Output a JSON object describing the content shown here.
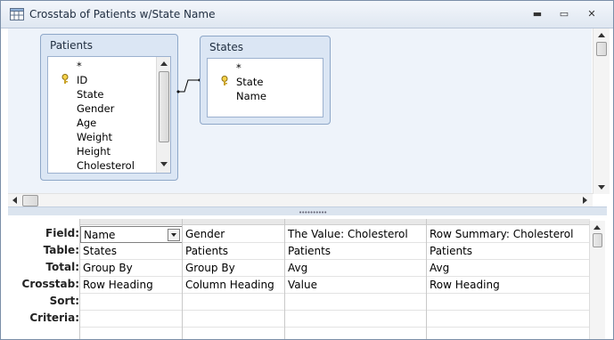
{
  "window": {
    "title": "Crosstab of Patients w/State Name",
    "minimize_glyph": "▬",
    "restore_glyph": "▭",
    "close_glyph": "✕"
  },
  "tables": {
    "patients": {
      "title": "Patients",
      "fields": [
        "*",
        "ID",
        "State",
        "Gender",
        "Age",
        "Weight",
        "Height",
        "Cholesterol"
      ],
      "key_field_index": 1
    },
    "states": {
      "title": "States",
      "fields": [
        "*",
        "State",
        "Name"
      ],
      "key_field_index": 1
    }
  },
  "grid": {
    "row_labels": [
      "Field:",
      "Table:",
      "Total:",
      "Crosstab:",
      "Sort:",
      "Criteria:"
    ],
    "columns": [
      {
        "field": "Name",
        "table": "States",
        "total": "Group By",
        "crosstab": "Row Heading",
        "sort": "",
        "criteria": ""
      },
      {
        "field": "Gender",
        "table": "Patients",
        "total": "Group By",
        "crosstab": "Column Heading",
        "sort": "",
        "criteria": ""
      },
      {
        "field": "The Value: Cholesterol",
        "table": "Patients",
        "total": "Avg",
        "crosstab": "Value",
        "sort": "",
        "criteria": ""
      },
      {
        "field": "Row Summary: Cholesterol",
        "table": "Patients",
        "total": "Avg",
        "crosstab": "Row Heading",
        "sort": "",
        "criteria": ""
      }
    ]
  },
  "colors": {
    "table_frame": "#dbe6f4",
    "design_background": "#eef3fa",
    "window_border": "#7a8ea8"
  }
}
